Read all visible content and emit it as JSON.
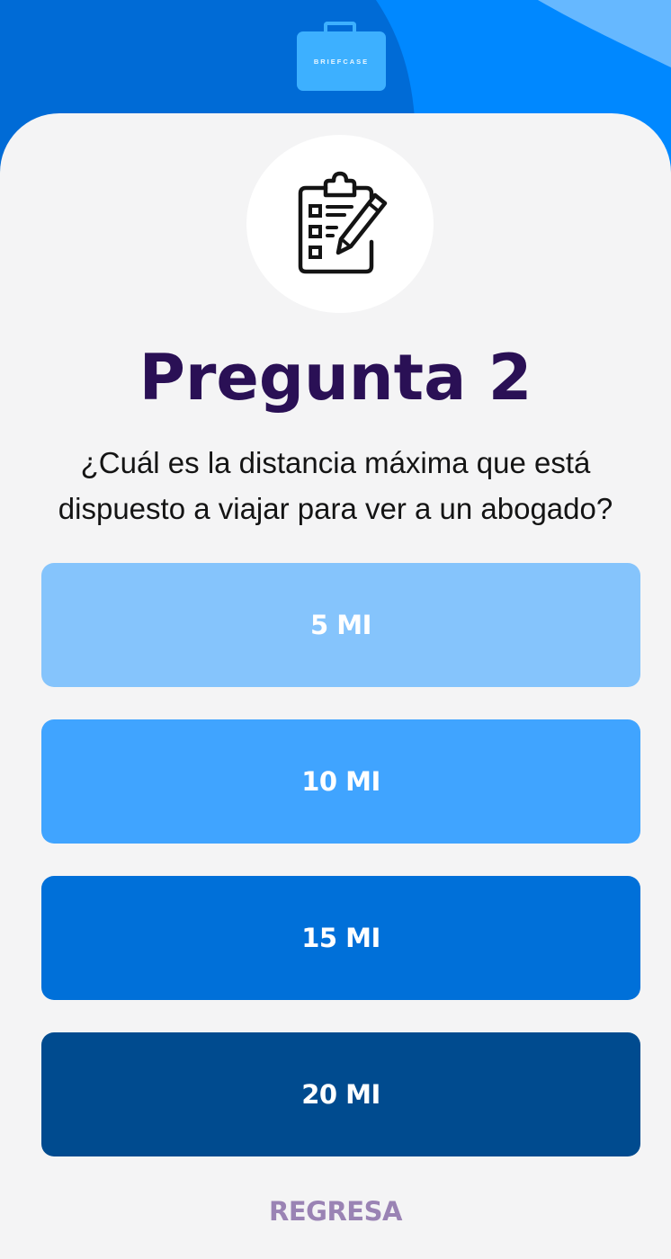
{
  "brand": {
    "logo_text": "BRIEFCASE"
  },
  "icons": {
    "question_icon": "clipboard-checklist-pencil-icon",
    "logo_icon": "briefcase-icon"
  },
  "question": {
    "title": "Pregunta 2",
    "text": "¿Cuál es la distancia máxima que está dispuesto a viajar para ver a un abogado?"
  },
  "options": [
    {
      "label": "5 MI",
      "color": "#85c4fc"
    },
    {
      "label": "10 MI",
      "color": "#40a4ff"
    },
    {
      "label": "15 MI",
      "color": "#0070d9"
    },
    {
      "label": "20 MI",
      "color": "#004b8f"
    }
  ],
  "navigation": {
    "back_label": "REGRESA"
  },
  "colors": {
    "header_dark": "#006bd6",
    "header_mid": "#0088ff",
    "header_light": "#66b8ff",
    "title": "#2a1055",
    "back_link": "#9a83b4",
    "background": "#f4f4f5"
  }
}
